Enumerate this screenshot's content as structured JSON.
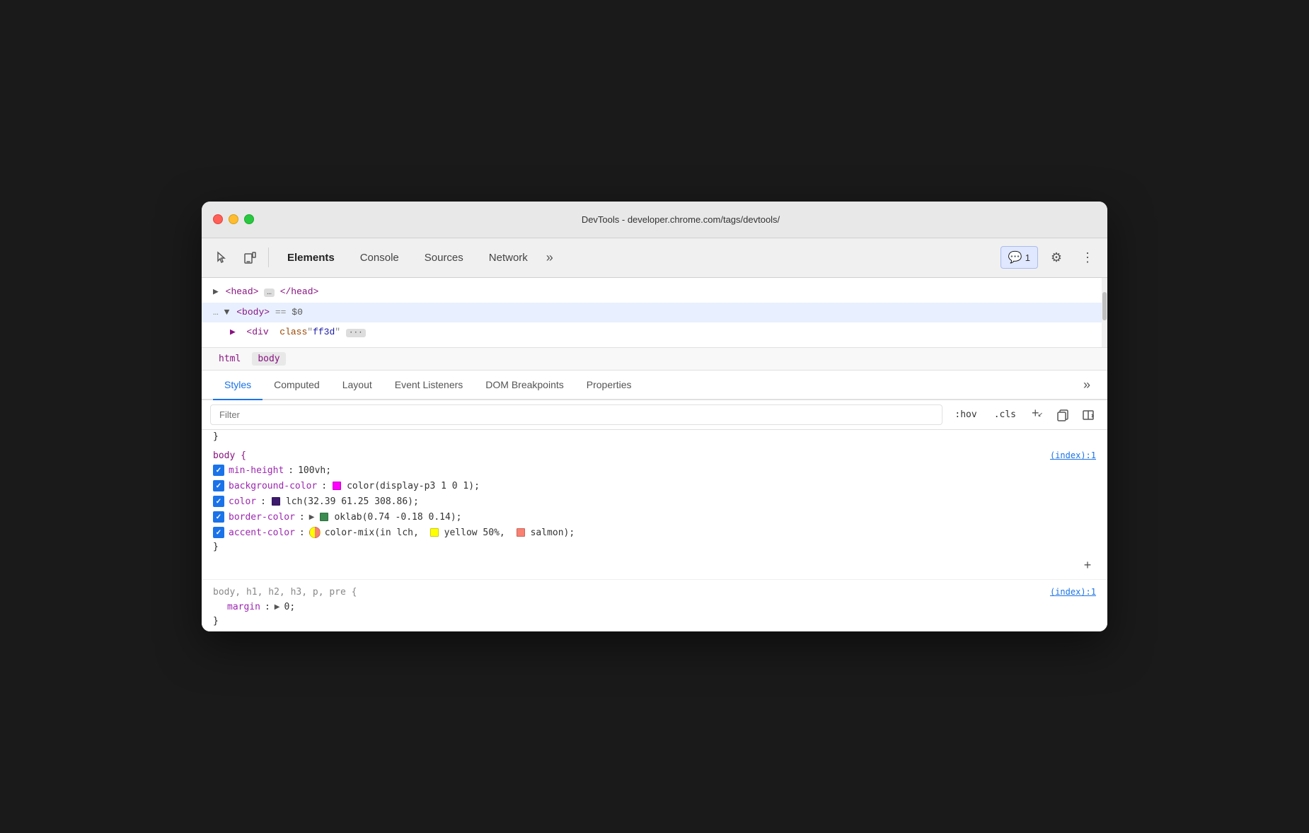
{
  "window": {
    "title": "DevTools - developer.chrome.com/tags/devtools/"
  },
  "toolbar": {
    "tabs": [
      {
        "label": "Elements",
        "active": true
      },
      {
        "label": "Console",
        "active": false
      },
      {
        "label": "Sources",
        "active": false
      },
      {
        "label": "Network",
        "active": false
      }
    ],
    "more_label": "»",
    "notification_count": "1",
    "settings_label": "⚙",
    "more_menu_label": "⋮"
  },
  "dom": {
    "head_line": "▶ <head> … </head>",
    "body_line": "… ▼ <body> == $0",
    "body_partial": "▶  <div  class\" ff3d\" ···"
  },
  "breadcrumbs": [
    {
      "label": "html",
      "active": false
    },
    {
      "label": "body",
      "active": true
    }
  ],
  "styles_tabs": [
    {
      "label": "Styles",
      "active": true
    },
    {
      "label": "Computed",
      "active": false
    },
    {
      "label": "Layout",
      "active": false
    },
    {
      "label": "Event Listeners",
      "active": false
    },
    {
      "label": "DOM Breakpoints",
      "active": false
    },
    {
      "label": "Properties",
      "active": false
    }
  ],
  "filter": {
    "placeholder": "Filter",
    "hov_label": ":hov",
    "cls_label": ".cls",
    "add_label": "+"
  },
  "css_rules": {
    "close_brace": "}",
    "rule1": {
      "selector": "body {",
      "source": "(index):1",
      "properties": [
        {
          "checked": true,
          "name": "min-height",
          "value": "100vh;"
        },
        {
          "checked": true,
          "name": "background-color",
          "value": "color(display-p3 1 0 1);",
          "swatch_color": "#ff00ff",
          "swatch_type": "solid"
        },
        {
          "checked": true,
          "name": "color",
          "value": "lch(32.39 61.25 308.86);",
          "swatch_color": "#3d1a6e",
          "swatch_type": "solid"
        },
        {
          "checked": true,
          "name": "border-color",
          "value": "oklab(0.74 -0.18 0.14);",
          "swatch_color": "#3a8c50",
          "swatch_type": "solid",
          "has_triangle": true
        },
        {
          "checked": true,
          "name": "accent-color",
          "value": "color-mix(in lch, yellow 50%, salmon);",
          "swatch_type": "mixed",
          "swatch_color1": "#ffff00",
          "swatch_color2": "#fa8072"
        }
      ],
      "close": "}"
    },
    "rule2": {
      "selector": "body, h1, h2, h3, p, pre {",
      "source": "(index):1",
      "properties": [
        {
          "name": "margin",
          "value": "0;",
          "has_triangle": true,
          "indent": true
        }
      ],
      "close": "}"
    }
  },
  "icons": {
    "cursor": "⬡",
    "device": "□",
    "notification": "💬",
    "settings": "⚙",
    "more": "⋮",
    "add_rule": "+",
    "force_state": ":hov",
    "toggle_class": ".cls",
    "new_style": "+",
    "copy_styles": "📋",
    "layout_toggle": "◁"
  }
}
